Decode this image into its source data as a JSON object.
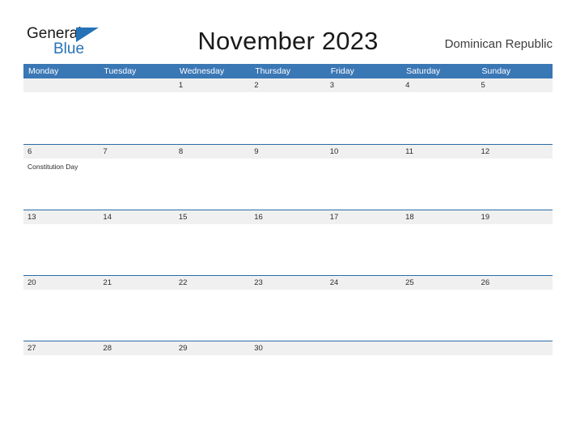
{
  "brand": {
    "name_line1": "General",
    "name_line2": "Blue",
    "accent_color": "#2572b6",
    "flag_icon": "triangle-flag-icon"
  },
  "header": {
    "title": "November 2023",
    "locale": "Dominican Republic"
  },
  "theme": {
    "header_blue": "#3a77b5",
    "row_divider_blue": "#2a6ba8",
    "daynum_band": "#f0f0f0",
    "text": "#2b2b2b"
  },
  "calendar": {
    "weekdays": [
      "Monday",
      "Tuesday",
      "Wednesday",
      "Thursday",
      "Friday",
      "Saturday",
      "Sunday"
    ],
    "weeks": [
      [
        {
          "day": "",
          "events": []
        },
        {
          "day": "",
          "events": []
        },
        {
          "day": "1",
          "events": []
        },
        {
          "day": "2",
          "events": []
        },
        {
          "day": "3",
          "events": []
        },
        {
          "day": "4",
          "events": []
        },
        {
          "day": "5",
          "events": []
        }
      ],
      [
        {
          "day": "6",
          "events": [
            "Constitution Day"
          ]
        },
        {
          "day": "7",
          "events": []
        },
        {
          "day": "8",
          "events": []
        },
        {
          "day": "9",
          "events": []
        },
        {
          "day": "10",
          "events": []
        },
        {
          "day": "11",
          "events": []
        },
        {
          "day": "12",
          "events": []
        }
      ],
      [
        {
          "day": "13",
          "events": []
        },
        {
          "day": "14",
          "events": []
        },
        {
          "day": "15",
          "events": []
        },
        {
          "day": "16",
          "events": []
        },
        {
          "day": "17",
          "events": []
        },
        {
          "day": "18",
          "events": []
        },
        {
          "day": "19",
          "events": []
        }
      ],
      [
        {
          "day": "20",
          "events": []
        },
        {
          "day": "21",
          "events": []
        },
        {
          "day": "22",
          "events": []
        },
        {
          "day": "23",
          "events": []
        },
        {
          "day": "24",
          "events": []
        },
        {
          "day": "25",
          "events": []
        },
        {
          "day": "26",
          "events": []
        }
      ],
      [
        {
          "day": "27",
          "events": []
        },
        {
          "day": "28",
          "events": []
        },
        {
          "day": "29",
          "events": []
        },
        {
          "day": "30",
          "events": []
        },
        {
          "day": "",
          "events": []
        },
        {
          "day": "",
          "events": []
        },
        {
          "day": "",
          "events": []
        }
      ]
    ]
  }
}
